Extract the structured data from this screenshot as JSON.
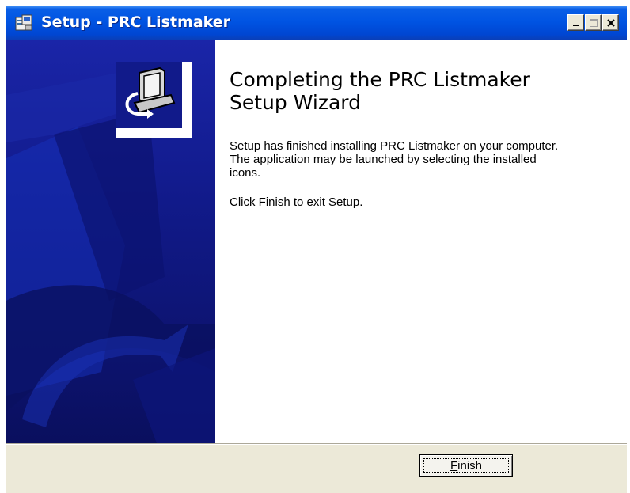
{
  "window": {
    "title": "Setup - PRC Listmaker",
    "icon": "setup-icon",
    "controls": [
      "minimize-icon",
      "maximize-icon",
      "close-icon"
    ]
  },
  "sidebar": {
    "logo": "installer-computer-icon",
    "background_color": "#111a8a"
  },
  "content": {
    "heading_line1": "Completing the PRC Listmaker",
    "heading_line2": "Setup Wizard",
    "paragraph1_line1": "Setup has finished installing PRC Listmaker on your computer.",
    "paragraph1_line2": "The application may be launched by selecting the installed",
    "paragraph1_line3": "icons.",
    "paragraph2": "Click Finish to exit Setup."
  },
  "footer": {
    "finish_accel": "F",
    "finish_rest": "inish"
  }
}
